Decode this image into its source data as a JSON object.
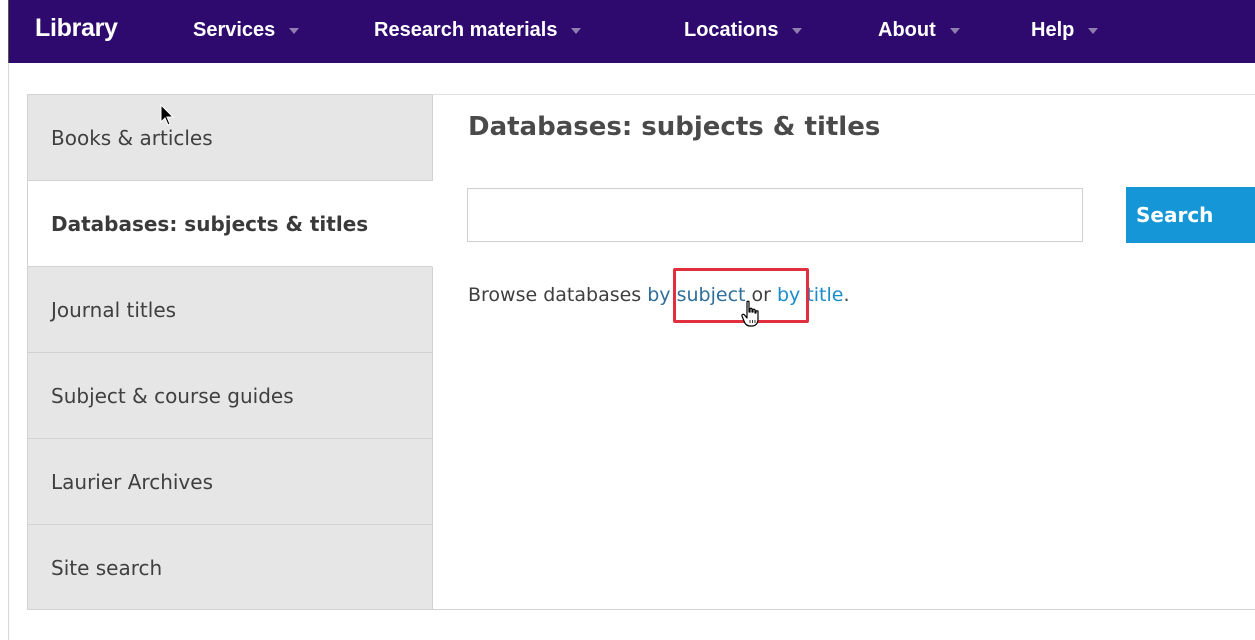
{
  "header": {
    "brand": "Library",
    "nav": [
      {
        "label": "Services"
      },
      {
        "label": "Research materials"
      },
      {
        "label": "Locations"
      },
      {
        "label": "About"
      },
      {
        "label": "Help"
      }
    ]
  },
  "sidebar": {
    "items": [
      {
        "label": "Books & articles"
      },
      {
        "label": "Databases: subjects & titles",
        "active": true
      },
      {
        "label": "Journal titles"
      },
      {
        "label": "Subject & course guides"
      },
      {
        "label": "Laurier Archives"
      },
      {
        "label": "Site search"
      }
    ]
  },
  "main": {
    "title": "Databases: subjects & titles",
    "search": {
      "value": "",
      "placeholder": "",
      "button_label": "Search"
    },
    "browse": {
      "prefix": "Browse databases ",
      "by_subject": "by subject",
      "middle": " or ",
      "by_title": "by title",
      "suffix": "."
    }
  },
  "colors": {
    "nav_bg": "#2e0a6e",
    "sidebar_bg": "#e6e6e6",
    "search_button": "#1596d6",
    "link": "#1a8ccc",
    "highlight": "#e0303f"
  },
  "icons": [
    "arrow-cursor-icon",
    "hand-cursor-icon",
    "caret-down-icon"
  ]
}
